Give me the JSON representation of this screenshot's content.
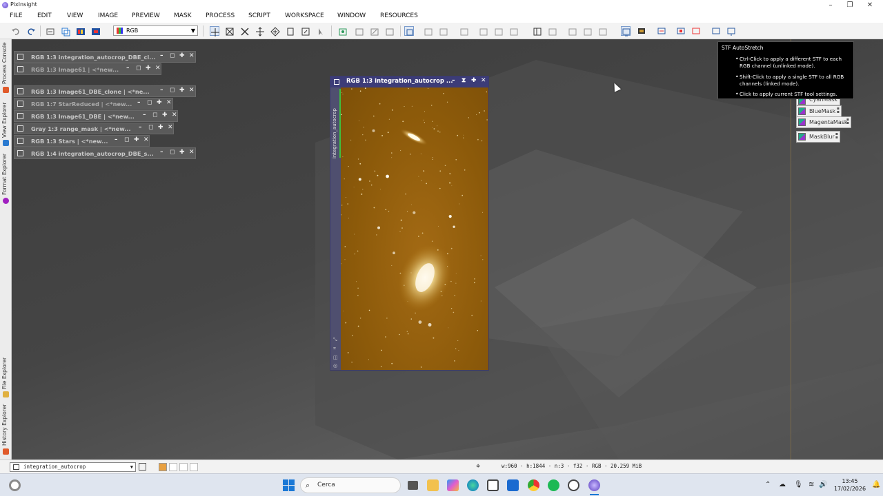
{
  "app": {
    "title": "PixInsight"
  },
  "menu": [
    "FILE",
    "EDIT",
    "VIEW",
    "IMAGE",
    "PREVIEW",
    "MASK",
    "PROCESS",
    "SCRIPT",
    "WORKSPACE",
    "WINDOW",
    "RESOURCES"
  ],
  "toolbar": {
    "rgb_select_value": "RGB"
  },
  "side_tabs": [
    "Process Console",
    "View Explorer",
    "Format Explorer",
    "File Explorer",
    "History Explorer"
  ],
  "icon_windows": [
    {
      "label": "RGB 1:3 integration_autocrop_DBE_cl..."
    },
    {
      "label": "RGB 1:3 Image61 | <*new..."
    },
    {
      "label": "RGB 1:3 Image61_DBE_clone | <*ne..."
    },
    {
      "label": "RGB 1:7 StarReduced | <*new..."
    },
    {
      "label": "RGB 1:3 Image61_DBE | <*new..."
    },
    {
      "label": "Gray 1:3 range_mask | <*new..."
    },
    {
      "label": "RGB 1:3 Stars | <*new..."
    },
    {
      "label": "RGB 1:4 integration_autocrop_DBE_s..."
    }
  ],
  "image_window": {
    "title": "RGB 1:3 integration_autocrop ...",
    "side_label": "integration_autocrop"
  },
  "masks": [
    {
      "label": "CyanMask"
    },
    {
      "label": "BlueMask"
    },
    {
      "label": "MagentaMask"
    },
    {
      "label": "MaskBlur"
    }
  ],
  "tooltip": {
    "title": "STF AutoStretch",
    "items": [
      "Ctrl-Click to apply a different STF to each RGB channel (unlinked mode).",
      "Shift-Click to apply a single STF to all RGB channels (linked mode).",
      "Click to apply current STF tool settings."
    ]
  },
  "statusbar": {
    "view_select_value": "integration_autocrop",
    "image_info": "w:960 · h:1844 · n:3 · f32 · RGB · 20.259 MiB"
  },
  "taskbar": {
    "search_placeholder": "Cerca",
    "time": "13:45",
    "date": "17/02/2026"
  },
  "colors": {
    "workspace_bg": "#454545",
    "image_title_bar": "#3c3c78",
    "image_bg": "#8c5a0a"
  }
}
